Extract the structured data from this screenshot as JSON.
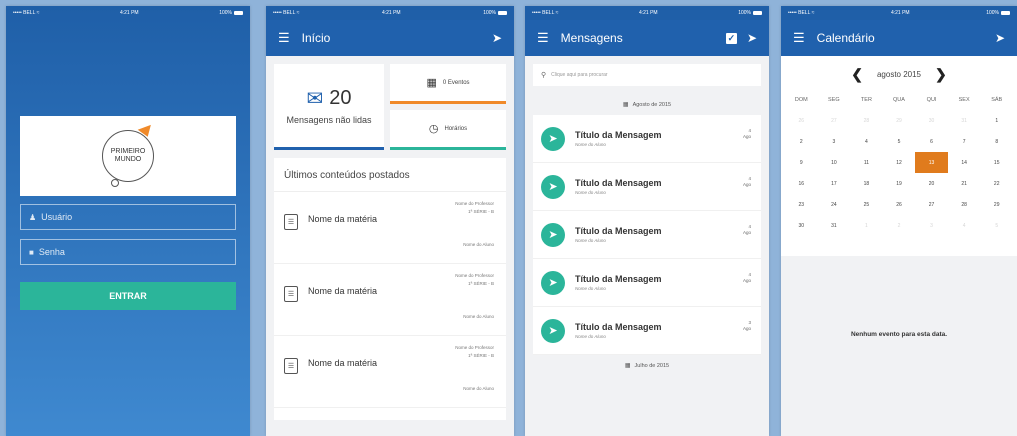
{
  "colors": {
    "primary": "#2061ad",
    "accent_green": "#2bb59a",
    "accent_orange": "#f08a2a",
    "selected_day": "#e07b1d"
  },
  "status": {
    "carrier": "••••• BELL ≈",
    "time": "4:21 PM",
    "battery": "100%"
  },
  "login": {
    "logo_line1": "PRIMEIRO",
    "logo_line2": "MUNDO",
    "user_placeholder": "Usuário",
    "pass_placeholder": "Senha",
    "submit_label": "ENTRAR",
    "user_icon": "person-icon",
    "lock_icon": "lock-icon"
  },
  "home": {
    "title": "Início",
    "message_count": "20",
    "message_label": "Mensagens não lidas",
    "events_label": "0 Eventos",
    "schedule_label": "Horários",
    "posts_heading": "Últimos conteúdos postados",
    "posts": [
      {
        "subject": "Nome da matéria",
        "teacher": "Nome do Professor",
        "grade": "1ª SÉRIE - B",
        "student": "Nome do Aluno"
      },
      {
        "subject": "Nome da matéria",
        "teacher": "Nome do Professor",
        "grade": "1ª SÉRIE - B",
        "student": "Nome do Aluno"
      },
      {
        "subject": "Nome da matéria",
        "teacher": "Nome do Professor",
        "grade": "1ª SÉRIE - B",
        "student": "Nome do Aluno"
      }
    ]
  },
  "messages": {
    "title": "Mensagens",
    "search_placeholder": "Clique aqui para procurar",
    "section_top": "Agosto de 2015",
    "section_bottom": "Julho de 2015",
    "items": [
      {
        "title": "Título da Mensagem",
        "sub": "Nome do Aluno",
        "day": "4",
        "month": "Ago"
      },
      {
        "title": "Título da Mensagem",
        "sub": "Nome do Aluno",
        "day": "4",
        "month": "Ago"
      },
      {
        "title": "Título da Mensagem",
        "sub": "Nome do Aluno",
        "day": "4",
        "month": "Ago"
      },
      {
        "title": "Título da Mensagem",
        "sub": "Nome do Aluno",
        "day": "4",
        "month": "Ago"
      },
      {
        "title": "Título da Mensagem",
        "sub": "Nome do Aluno",
        "day": "3",
        "month": "Ago"
      }
    ]
  },
  "calendar": {
    "title": "Calendário",
    "month_label": "agosto 2015",
    "weekdays": [
      "DOM",
      "SEG",
      "TER",
      "QUA",
      "QUI",
      "SEX",
      "SÁB"
    ],
    "days": [
      {
        "d": "26",
        "m": true
      },
      {
        "d": "27",
        "m": true
      },
      {
        "d": "28",
        "m": true
      },
      {
        "d": "29",
        "m": true
      },
      {
        "d": "30",
        "m": true
      },
      {
        "d": "31",
        "m": true
      },
      {
        "d": "1",
        "m": false
      },
      {
        "d": "2",
        "m": false
      },
      {
        "d": "3",
        "m": false
      },
      {
        "d": "4",
        "m": false
      },
      {
        "d": "5",
        "m": false
      },
      {
        "d": "6",
        "m": false
      },
      {
        "d": "7",
        "m": false
      },
      {
        "d": "8",
        "m": false
      },
      {
        "d": "9",
        "m": false
      },
      {
        "d": "10",
        "m": false
      },
      {
        "d": "11",
        "m": false
      },
      {
        "d": "12",
        "m": false
      },
      {
        "d": "13",
        "m": false,
        "sel": true
      },
      {
        "d": "14",
        "m": false
      },
      {
        "d": "15",
        "m": false
      },
      {
        "d": "16",
        "m": false
      },
      {
        "d": "17",
        "m": false
      },
      {
        "d": "18",
        "m": false
      },
      {
        "d": "19",
        "m": false
      },
      {
        "d": "20",
        "m": false
      },
      {
        "d": "21",
        "m": false
      },
      {
        "d": "22",
        "m": false
      },
      {
        "d": "23",
        "m": false
      },
      {
        "d": "24",
        "m": false
      },
      {
        "d": "25",
        "m": false
      },
      {
        "d": "26",
        "m": false
      },
      {
        "d": "27",
        "m": false
      },
      {
        "d": "28",
        "m": false
      },
      {
        "d": "29",
        "m": false
      },
      {
        "d": "30",
        "m": false
      },
      {
        "d": "31",
        "m": false
      },
      {
        "d": "1",
        "m": true
      },
      {
        "d": "2",
        "m": true
      },
      {
        "d": "3",
        "m": true
      },
      {
        "d": "4",
        "m": true
      },
      {
        "d": "5",
        "m": true
      }
    ],
    "empty_message": "Nenhum evento para esta data."
  }
}
